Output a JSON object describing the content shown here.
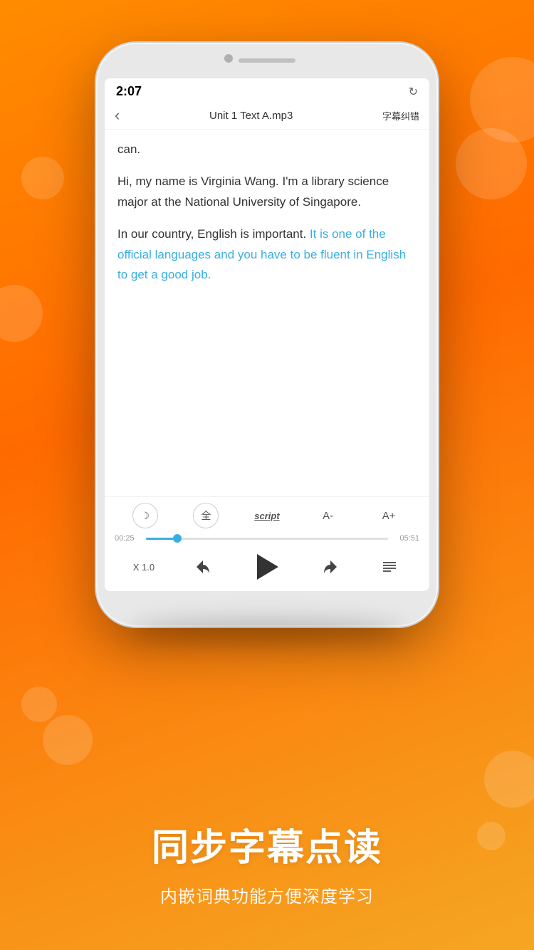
{
  "background": {
    "gradient_start": "#FF8C00",
    "gradient_end": "#F5A623"
  },
  "phone": {
    "status_bar": {
      "time": "2:07",
      "refresh_icon": "↻"
    },
    "nav": {
      "back_icon": "‹",
      "title": "Unit 1 Text A.mp3",
      "action": "字幕纠错"
    },
    "content": {
      "line_0": "can.",
      "paragraph1": "Hi, my name is Virginia Wang. I'm a library science major at the National University of Singapore.",
      "paragraph2_normal": "In our country, English is important. ",
      "paragraph2_highlight": "It is one of the official languages and you have to be fluent in English to get a good job."
    },
    "player": {
      "icons": [
        {
          "label": "月亮",
          "symbol": "☽",
          "type": "icon"
        },
        {
          "label": "全",
          "symbol": "全",
          "type": "text"
        },
        {
          "label": "script",
          "symbol": "script",
          "type": "script"
        },
        {
          "label": "A-",
          "symbol": "A-",
          "type": "text"
        },
        {
          "label": "A+",
          "symbol": "A+",
          "type": "text"
        }
      ],
      "current_time": "00:25",
      "total_time": "05:51",
      "progress_percent": 13,
      "speed": "X 1.0",
      "play_icon": "▶"
    }
  },
  "bottom": {
    "main_heading": "同步字幕点读",
    "sub_heading": "内嵌词典功能方便深度学习"
  }
}
